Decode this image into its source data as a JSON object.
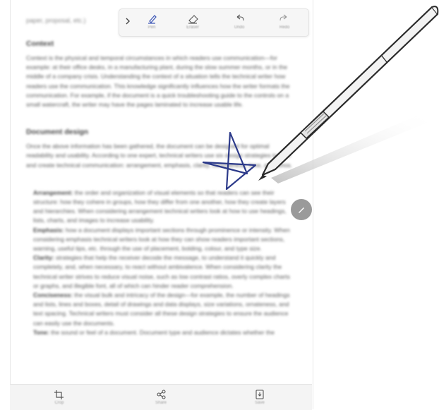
{
  "document": {
    "breadcrumb": "paper, proposal, etc.)",
    "sections": [
      {
        "heading": "Context",
        "body": "Context is the physical and temporal circumstances in which readers use communication—for example: at their office desks, in a manufacturing plant, during the slow summer months, or in the middle of a company crisis. Understanding the context of a situation tells the technical writer how readers use the communication. This knowledge significantly influences how the writer formats the communication. For example, if the document is a quick troubleshooting guide to the controls on a small watercraft, the writer may have the pages laminated to increase usable life."
      },
      {
        "heading": "Document design",
        "body": "Once the above information has been gathered, the document can be designed for optimal readability and usability. According to one expert, technical writers use six design strategies to plan and create technical communication: arrangement, emphasis, clarity, conciseness, tone, and ethos."
      }
    ],
    "bullets": [
      {
        "term": "Arrangement:",
        "text": "the order and organization of visual elements so that readers can see their structure: how they cohere in groups, how they differ from one another, how they create layers and hierarchies. When considering arrangement technical writers look at how to use headings, lists, charts, and images to increase usability."
      },
      {
        "term": "Emphasis:",
        "text": "how a document displays important sections through prominence or intensity. When considering emphasis technical writers look at how they can show readers important sections, warning, useful tips, etc. through the use of placement, bolding, colour, and type size."
      },
      {
        "term": "Clarity:",
        "text": "strategies that help the receiver decode the message, to understand it quickly and completely, and, when necessary, to react without ambivalence. When considering clarity the technical writer strives to reduce visual noise, such as low contrast ratios, overly complex charts or graphs, and illegible font, all of which can hinder reader comprehension."
      },
      {
        "term": "Conciseness:",
        "text": "the visual bulk and intricacy of the design—for example, the number of headings and lists, lines and boxes, detail of drawings and data displays, size variations, ornateness, and text spacing. Technical writers must consider all these design strategies to ensure the audience can easily use the documents."
      },
      {
        "term": "Tone:",
        "text": "the sound or feel of a document. Document type and audience dictates whether the"
      }
    ]
  },
  "toolbar": {
    "items": [
      {
        "icon": "pen-icon",
        "label": "Pen"
      },
      {
        "icon": "eraser-icon",
        "label": "Eraser"
      },
      {
        "icon": "undo-icon",
        "label": "Undo"
      },
      {
        "icon": "redo-icon",
        "label": "Redo"
      }
    ]
  },
  "bottombar": {
    "items": [
      {
        "icon": "crop-icon",
        "label": "Crop"
      },
      {
        "icon": "share-icon",
        "label": "Share"
      },
      {
        "icon": "save-icon",
        "label": "Save"
      }
    ]
  },
  "colors": {
    "pen_stroke": "#2c3a8a",
    "pen_icon_active": "#3a55b6",
    "fab": "#9a9a9a",
    "text": "#5a5a5a"
  }
}
